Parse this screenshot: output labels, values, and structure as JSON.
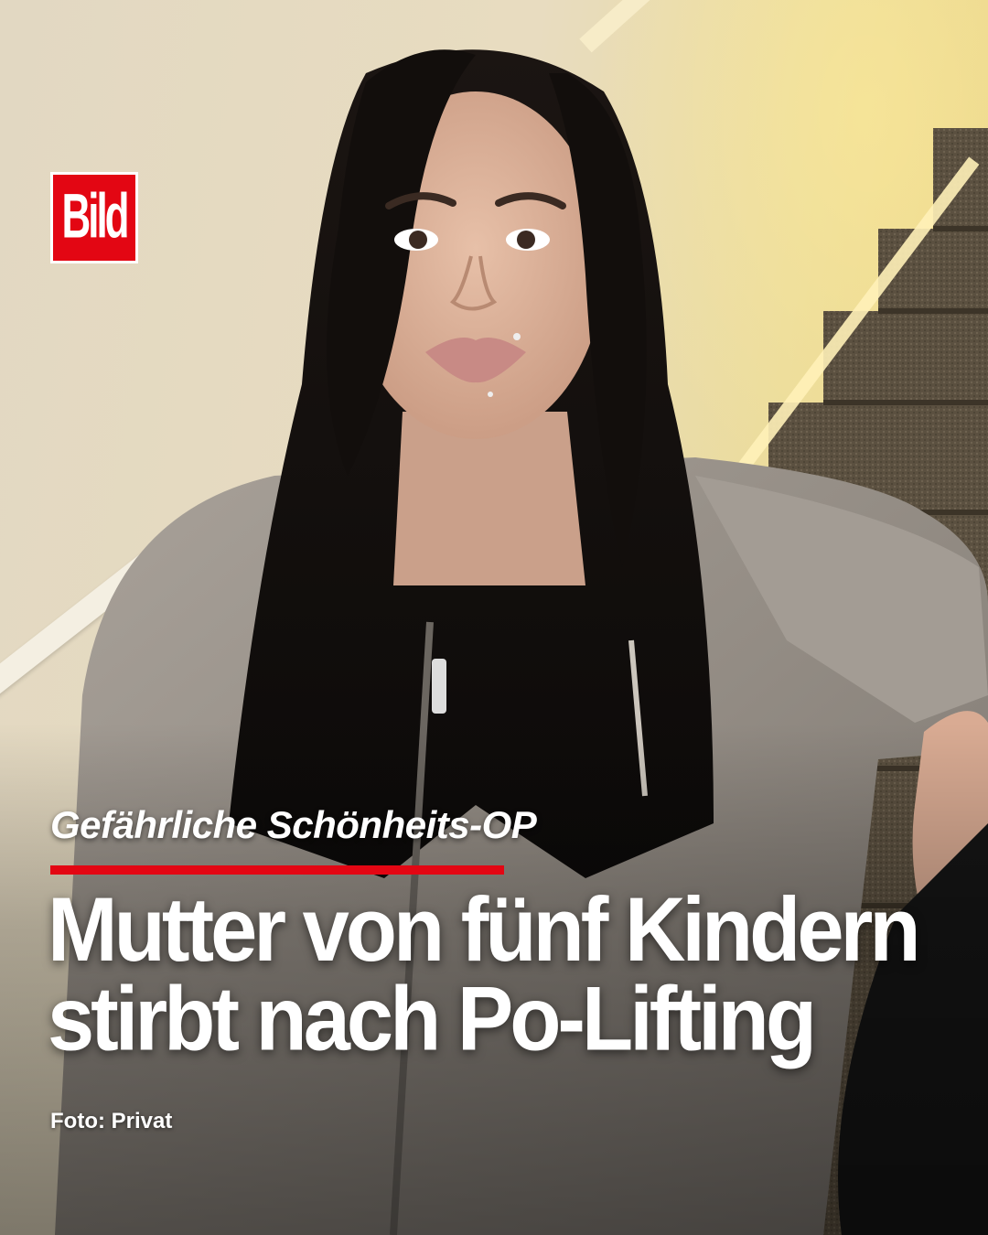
{
  "brand": {
    "logo_text": "Bild",
    "accent_color": "#e30613"
  },
  "post": {
    "kicker": "Gefährliche Schönheits-OP",
    "headline_line1": "Mutter von fünf Kindern",
    "headline_line2": "stirbt nach Po-Lifting",
    "photo_credit": "Foto: Privat"
  }
}
